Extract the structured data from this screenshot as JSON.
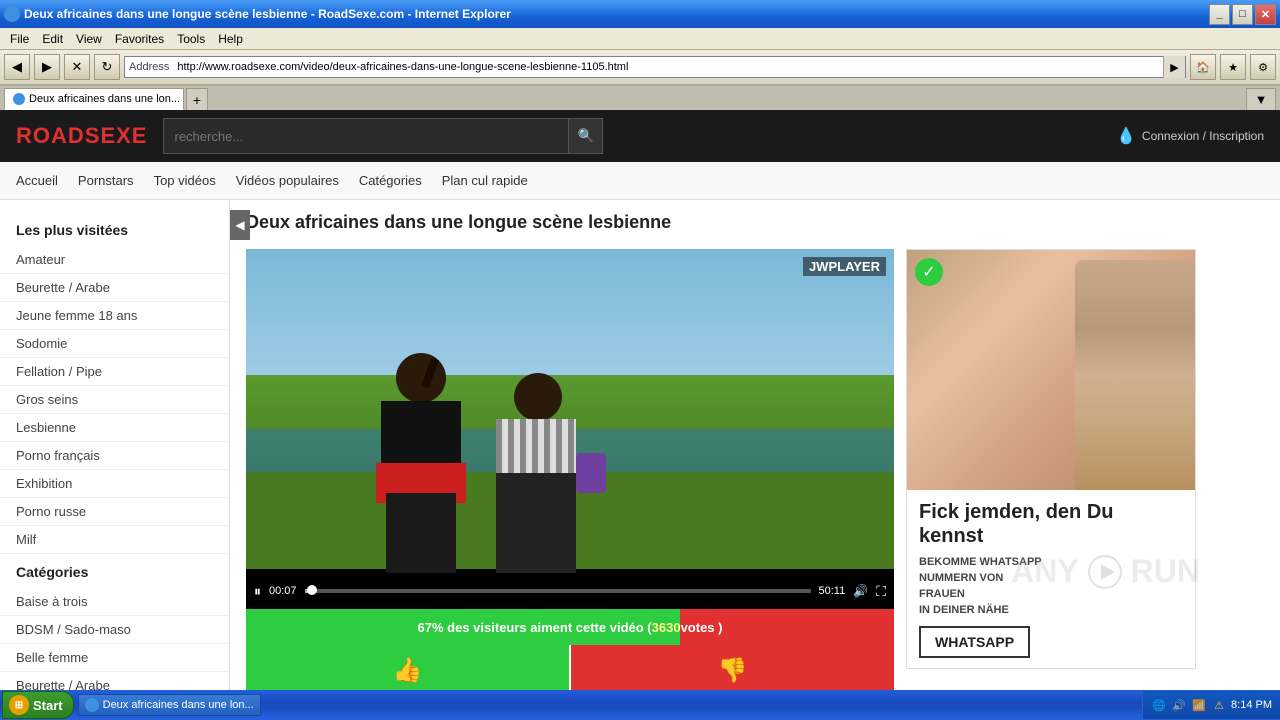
{
  "window": {
    "title": "Deux africaines dans une longue scène lesbienne - RoadSexe.com - Internet Explorer",
    "url": "http://www.roadsexe.com/video/deux-africaines-dans-une-longue-scene-lesbienne-1105.html"
  },
  "ie": {
    "back_tooltip": "Back",
    "forward_tooltip": "Forward",
    "refresh_tooltip": "Refresh",
    "address_label": "Address",
    "tab_text": "Deux africaines dans une lon...",
    "tab_new": "+",
    "menu": [
      "File",
      "Edit",
      "View",
      "Favorites",
      "Tools",
      "Help"
    ]
  },
  "site": {
    "logo_part1": "ROAD",
    "logo_part2": "SEXE",
    "search_placeholder": "recherche...",
    "login_text": "Connexion / Inscription",
    "nav": [
      "Accueil",
      "Pornstars",
      "Top vidéos",
      "Vidéos populaires",
      "Catégories",
      "Plan cul rapide"
    ]
  },
  "sidebar": {
    "popular_title": "Les plus visitées",
    "popular_items": [
      "Amateur",
      "Beurette / Arabe",
      "Jeune femme 18 ans",
      "Sodomie",
      "Fellation / Pipe",
      "Gros seins",
      "Lesbienne",
      "Porno français",
      "Exhibition",
      "Porno russe",
      "Milf"
    ],
    "categories_title": "Catégories",
    "categories_items": [
      "Baise à trois",
      "BDSM / Sado-maso",
      "Belle femme",
      "Beurette / Arabe"
    ]
  },
  "video": {
    "title": "Deux africaines dans une longue scène lesbienne",
    "jwplayer_label": "JWPLAYER",
    "time_current": "00:07",
    "time_total": "50:11",
    "rating_text": "67% des visiteurs aiment cette vidéo ( ",
    "rating_votes": "3630",
    "rating_suffix": " votes )",
    "vote_like_icon": "👍",
    "vote_dislike_icon": "👎"
  },
  "ad": {
    "check_icon": "✓",
    "headline": "Fick jemden, den Du kennst",
    "line1": "BEKOMME WHATSAPP",
    "line2": "NUMMERN VON",
    "line3": "FRAUEN",
    "line4": "IN DEINER NÄHE",
    "button_text": "WHATSAPP"
  },
  "taskbar": {
    "start_label": "Start",
    "task_label": "Deux africaines dans une lon...",
    "time": "8:14 PM"
  },
  "anyrun": "ANY RUN"
}
